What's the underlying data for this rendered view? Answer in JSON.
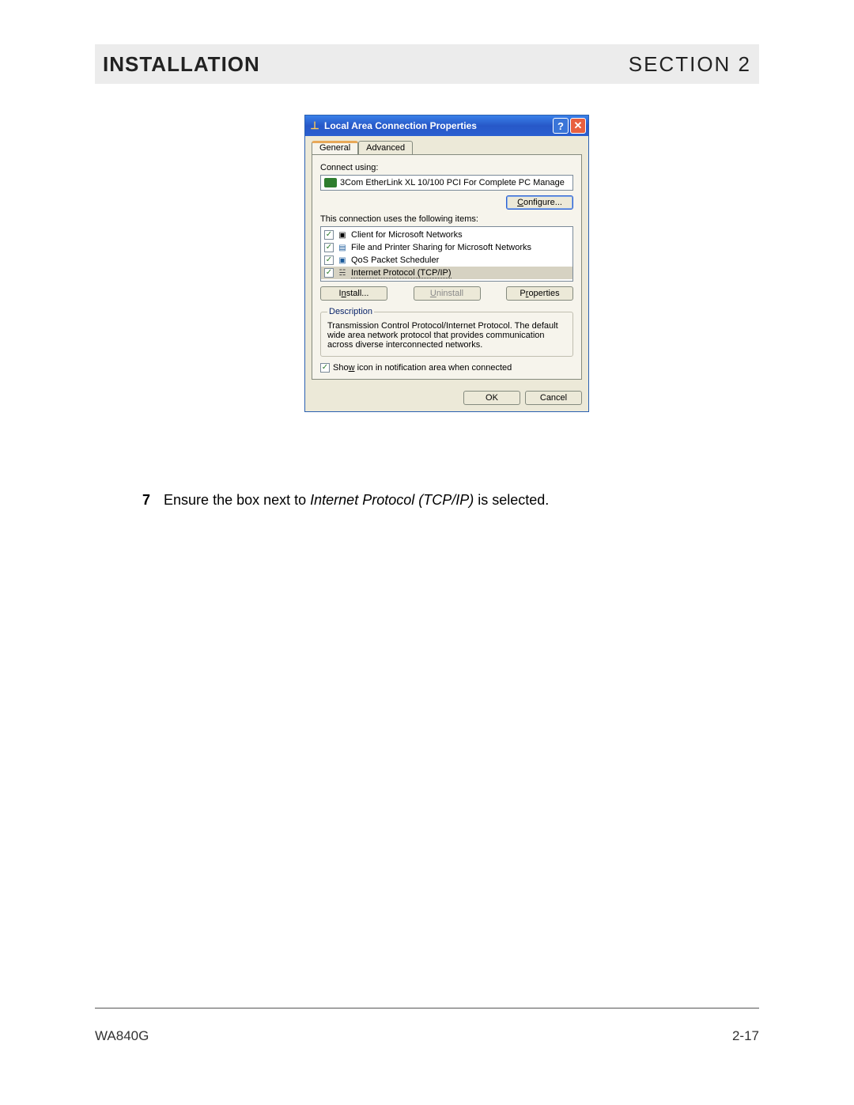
{
  "header": {
    "left": "INSTALLATION",
    "right": "SECTION 2"
  },
  "dialog": {
    "title": "Local Area Connection Properties",
    "tabs": {
      "general": "General",
      "advanced": "Advanced"
    },
    "connect_using_label": "Connect using:",
    "adapter": "3Com EtherLink XL 10/100 PCI For Complete PC Manage",
    "configure_btn": "Configure...",
    "items_label": "This connection uses the following items:",
    "items": [
      {
        "label": "Client for Microsoft Networks"
      },
      {
        "label": "File and Printer Sharing for Microsoft Networks"
      },
      {
        "label": "QoS Packet Scheduler"
      },
      {
        "label": "Internet Protocol (TCP/IP)"
      }
    ],
    "install_btn": "Install...",
    "uninstall_btn": "Uninstall",
    "properties_btn": "Properties",
    "desc_legend": "Description",
    "desc_text": "Transmission Control Protocol/Internet Protocol. The default wide area network protocol that provides communication across diverse interconnected networks.",
    "notify_label": "Show icon in notification area when connected",
    "ok_btn": "OK",
    "cancel_btn": "Cancel"
  },
  "instruction": {
    "number": "7",
    "before": "Ensure the box next to ",
    "italic": "Internet Protocol (TCP/IP)",
    "after": " is selected."
  },
  "footer": {
    "model": "WA840G",
    "page": "2-17"
  }
}
